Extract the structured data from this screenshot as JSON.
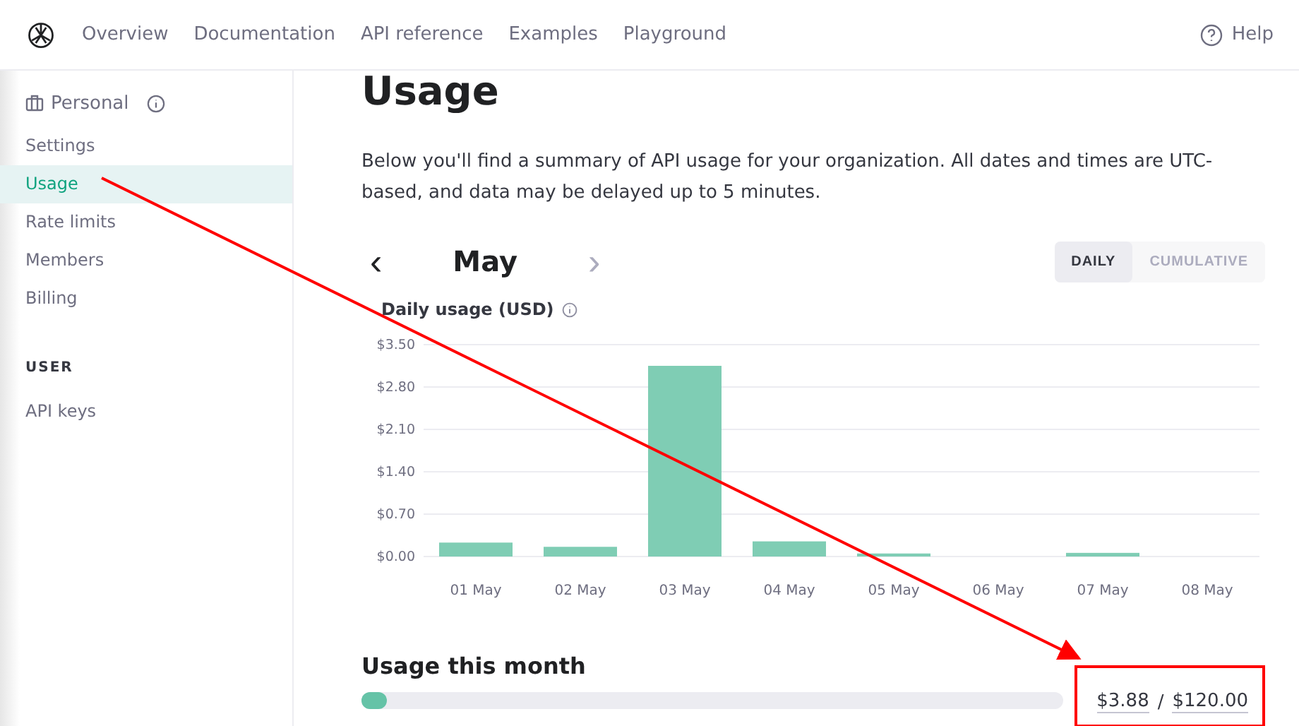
{
  "nav": {
    "links": [
      {
        "label": "Overview"
      },
      {
        "label": "Documentation"
      },
      {
        "label": "API reference"
      },
      {
        "label": "Examples"
      },
      {
        "label": "Playground"
      }
    ],
    "help": "Help"
  },
  "sidebar": {
    "org": "Personal",
    "items": [
      {
        "label": "Settings",
        "selected": false
      },
      {
        "label": "Usage",
        "selected": true
      },
      {
        "label": "Rate limits",
        "selected": false
      },
      {
        "label": "Members",
        "selected": false
      },
      {
        "label": "Billing",
        "selected": false
      }
    ],
    "section": "USER",
    "user_items": [
      {
        "label": "API keys",
        "selected": false
      }
    ]
  },
  "page": {
    "title": "Usage",
    "description": "Below you'll find a summary of API usage for your organization. All dates and times are UTC-based, and data may be delayed up to 5 minutes.",
    "month": "May",
    "prev": "‹",
    "next": "›",
    "toggles": [
      {
        "label": "DAILY",
        "selected": true
      },
      {
        "label": "CUMULATIVE",
        "selected": false
      }
    ]
  },
  "chart": {
    "chart_data": {
      "type": "bar",
      "title": "Daily usage (USD)",
      "categories": [
        "01 May",
        "02 May",
        "03 May",
        "04 May",
        "05 May",
        "06 May",
        "07 May",
        "08 May"
      ],
      "grid": true,
      "series": [
        {
          "color": "#7fcdb4",
          "values": [
            0.23,
            0.16,
            3.15,
            0.25,
            0.05,
            0,
            0.06,
            0
          ]
        }
      ],
      "ylim": [
        0,
        3.5
      ],
      "yticks": [
        {
          "value": 0,
          "label": "$0.00"
        },
        {
          "value": 0.7,
          "label": "$0.70"
        },
        {
          "value": 1.4,
          "label": "$1.40"
        },
        {
          "value": 2.1,
          "label": "$2.10"
        },
        {
          "value": 2.8,
          "label": "$2.80"
        },
        {
          "value": 3.5,
          "label": "$3.50"
        }
      ]
    }
  },
  "month_usage": {
    "title": "Usage this month",
    "level": 0.032,
    "used": "$3.88",
    "separator": "/",
    "limit": "$120.00"
  }
}
